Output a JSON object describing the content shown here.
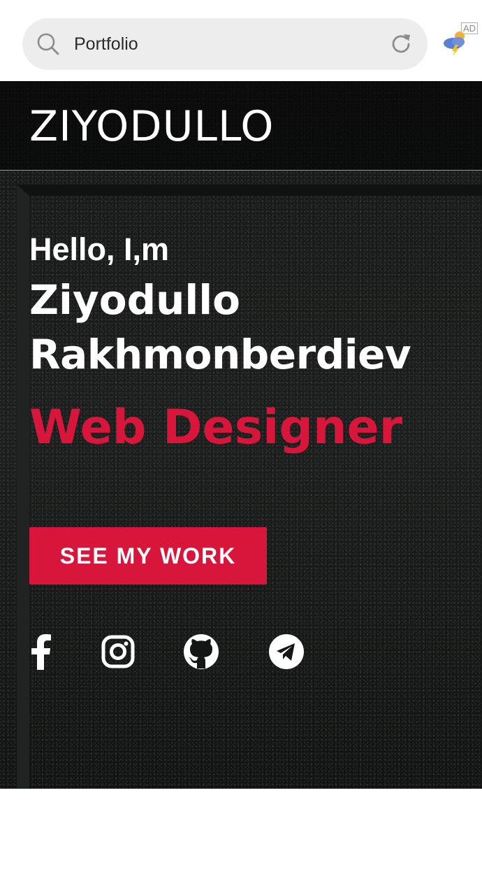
{
  "browser": {
    "search_value": "Portfolio",
    "ad_label": "AD",
    "icons": [
      "search-icon",
      "reload-icon",
      "weather-icon"
    ]
  },
  "site": {
    "logo": "ZIYODULLO",
    "hero": {
      "greeting": "Hello, I,m",
      "name_first": "Ziyodullo",
      "name_last": "Rakhmonberdiev",
      "role": "Web Designer",
      "cta_label": "SEE MY WORK"
    },
    "social_icons": [
      "facebook-icon",
      "instagram-icon",
      "github-icon",
      "telegram-icon"
    ]
  },
  "colors": {
    "accent": "#d8163c",
    "background": "#141615",
    "text": "#ffffff",
    "search_pill": "#ededed"
  }
}
